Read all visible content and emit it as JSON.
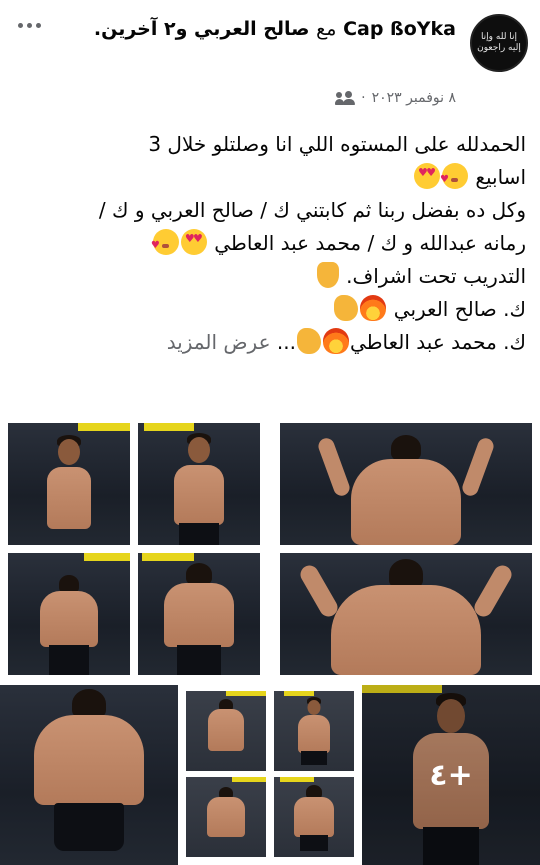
{
  "post": {
    "author_name": "Cap ßoYka",
    "with_word": "مع",
    "tagged_name": "صالح العربي",
    "others_text": "و٢ آخرين.",
    "date": "٨ نوفمبر ٢٠٢٣",
    "separator": "·",
    "avatar_text": "إنا لله وإنا إليه راجعون",
    "lines": [
      "الحمدلله على المستوه اللي انا وصلتلو خلال 3",
      "اسابيع",
      "وكل ده بفضل ربنا ثم كابتني ك / صالح العربي و ك /",
      "رمانه عبدالله و ك / محمد عبد العاطي",
      "التدريب تحت اشراف.",
      "ك. صالح العربي",
      "ك. محمد عبد العاطي"
    ],
    "ellipsis": "...",
    "see_more": "عرض المزيد"
  },
  "icons": {
    "more": "more-options-icon",
    "audience": "friends-audience-icon",
    "emoji_1": "kiss-face-emoji",
    "emoji_2": "heart-eyes-emoji",
    "emoji_3": "point-down-emoji",
    "emoji_4": "flexed-biceps-emoji",
    "emoji_5": "fire-emoji"
  },
  "photos": {
    "count": 12,
    "more_count_label": "+٤"
  },
  "colors": {
    "text": "#050505",
    "secondary": "#65676b",
    "emoji_yellow": "#ffcc33",
    "strip_yellow": "#e6d51c"
  }
}
